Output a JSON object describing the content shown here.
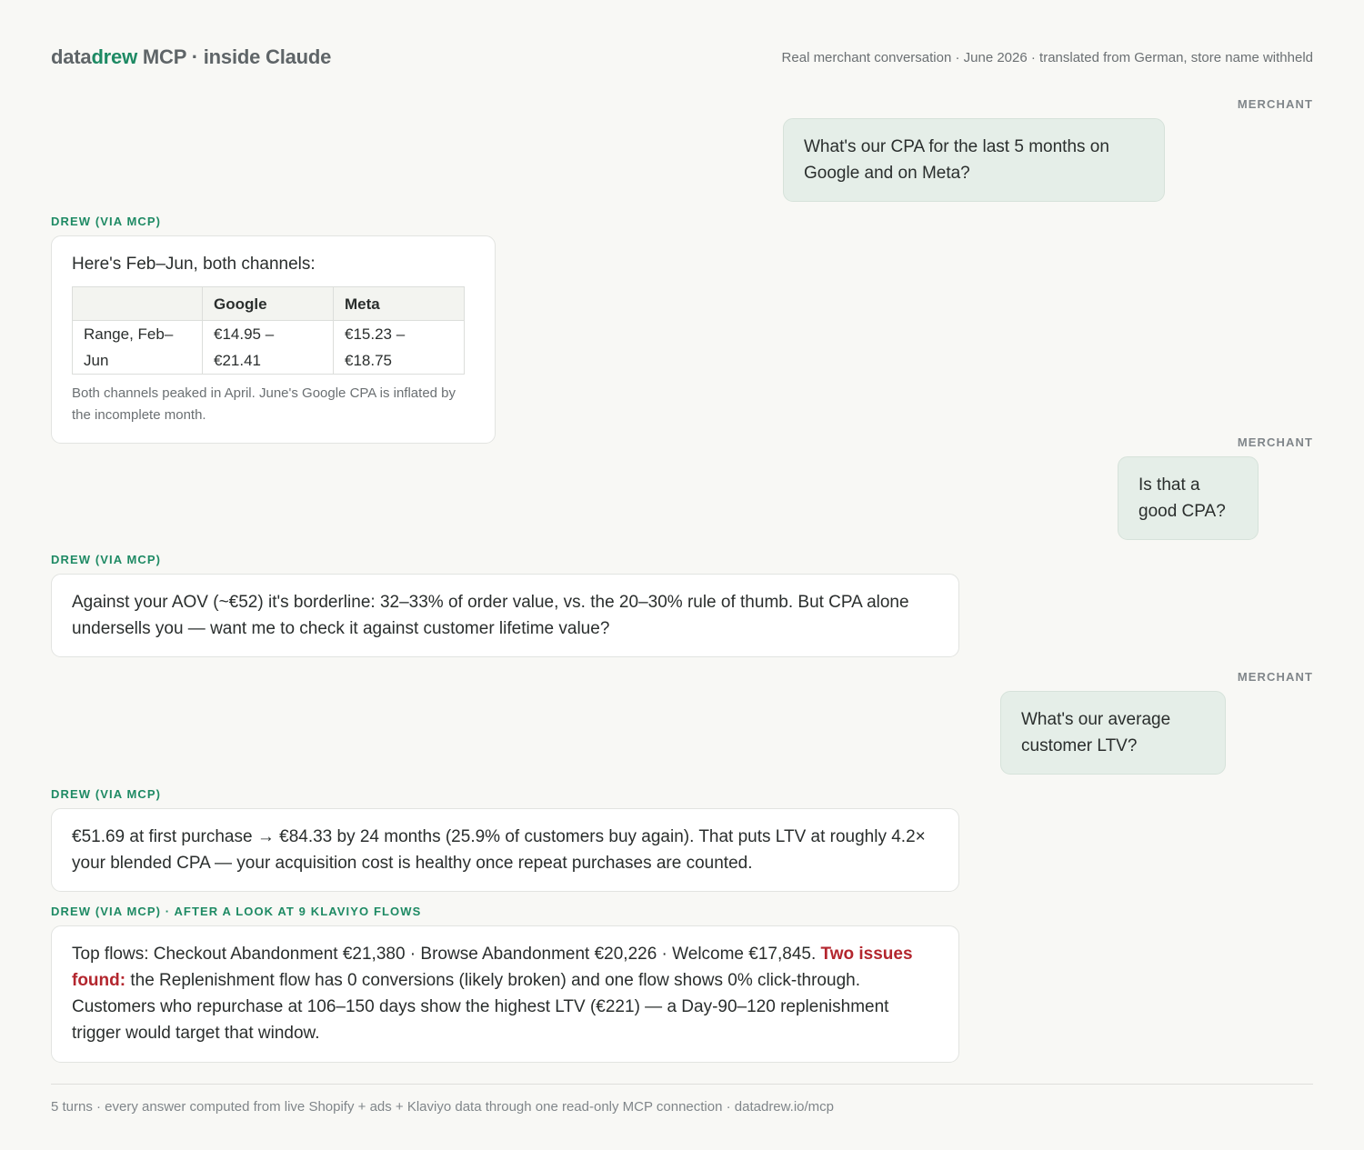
{
  "header": {
    "brand_data": "data",
    "brand_drew": "drew",
    "brand_rest": " MCP · inside Claude",
    "subtitle": "Real merchant conversation · June 2026 · translated from German, store name withheld"
  },
  "roles": {
    "merchant": "MERCHANT",
    "drew": "DREW (VIA MCP)",
    "drew_klaviyo": "DREW (VIA MCP) · AFTER A LOOK AT 9 KLAVIYO FLOWS"
  },
  "conversation": {
    "q1": "What's our CPA for the last 5 months on Google and on Meta?",
    "a1": {
      "intro": "Here's Feb–Jun, both channels:",
      "table": {
        "headers": [
          "",
          "Google",
          "Meta"
        ],
        "rows": [
          [
            "Range, Feb–Jun",
            "€14.95 – €21.41",
            "€15.23 – €18.75"
          ]
        ]
      },
      "note": "Both channels peaked in April. June's Google CPA is inflated by the incomplete month."
    },
    "q2": "Is that a good CPA?",
    "a2": "Against your AOV (~€52) it's borderline: 32–33% of order value, vs. the 20–30% rule of thumb. But CPA alone undersells you — want me to check it against customer lifetime value?",
    "q3": "What's our average customer LTV?",
    "a3": "€51.69 at first purchase → €84.33 by 24 months (25.9% of customers buy again). That puts LTV at roughly 4.2× your blended CPA — your acquisition cost is healthy once repeat purchases are counted.",
    "a4": {
      "lead": "Top flows: Checkout Abandonment €21,380 · Browse Abandonment €20,226 · Welcome €17,845. ",
      "highlight": "Two issues found:",
      "rest": " the Replenishment flow has 0 conversions (likely broken) and one flow shows 0% click-through. Customers who repurchase at 106–150 days show the highest LTV (€221) — a Day-90–120 replenishment trigger would target that window."
    }
  },
  "footer": {
    "text": "5 turns · every answer computed from live Shopify + ads + Klaviyo data through one read-only MCP connection · datadrew.io/mcp"
  },
  "colors": {
    "accent_green": "#1e8a64",
    "issue_red": "#b3262e",
    "user_bubble": "#e5eee8"
  }
}
